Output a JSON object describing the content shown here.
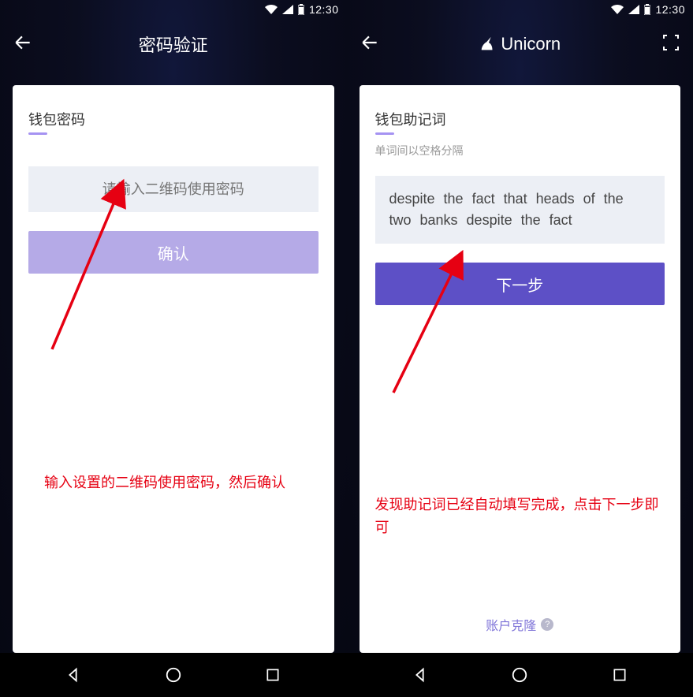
{
  "status": {
    "time": "12:30"
  },
  "left": {
    "header_title": "密码验证",
    "section_title": "钱包密码",
    "input_placeholder": "请输入二维码使用密码",
    "confirm_label": "确认",
    "annotation": "输入设置的二维码使用密码，然后确认"
  },
  "right": {
    "header_title": "Unicorn",
    "section_title": "钱包助记词",
    "hint": "单词间以空格分隔",
    "mnemonic": "despite the fact that heads of the two banks despite the fact",
    "next_label": "下一步",
    "annotation": "发现助记词已经自动填写完成，点击下一步即可",
    "clone_label": "账户克隆"
  },
  "colors": {
    "primary": "#5d50c6",
    "secondary": "#b5aae7",
    "annotation": "#e60012"
  }
}
